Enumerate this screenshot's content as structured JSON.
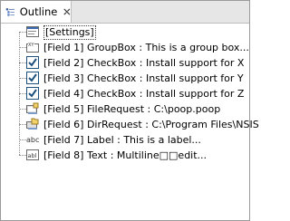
{
  "tab": {
    "label": "Outline"
  },
  "tree": {
    "items": [
      {
        "label": "[Settings]",
        "icon": "settings-icon"
      },
      {
        "label": "[Field 1] GroupBox :  This is a group box...",
        "icon": "groupbox-icon"
      },
      {
        "label": "[Field 2] CheckBox : Install support for X",
        "icon": "checkbox-icon"
      },
      {
        "label": "[Field 3] CheckBox : Install support for Y",
        "icon": "checkbox-icon"
      },
      {
        "label": "[Field 4] CheckBox : Install support for Z",
        "icon": "checkbox-icon"
      },
      {
        "label": "[Field 5] FileRequest : C:\\poop.poop",
        "icon": "file-request-icon"
      },
      {
        "label": "[Field 6] DirRequest : C:\\Program Files\\NSIS",
        "icon": "dir-request-icon"
      },
      {
        "label": "[Field 7] Label : This is a label...",
        "icon": "label-icon"
      },
      {
        "label": "[Field 8] Text : Multiline□□edit...",
        "icon": "text-icon"
      }
    ]
  }
}
